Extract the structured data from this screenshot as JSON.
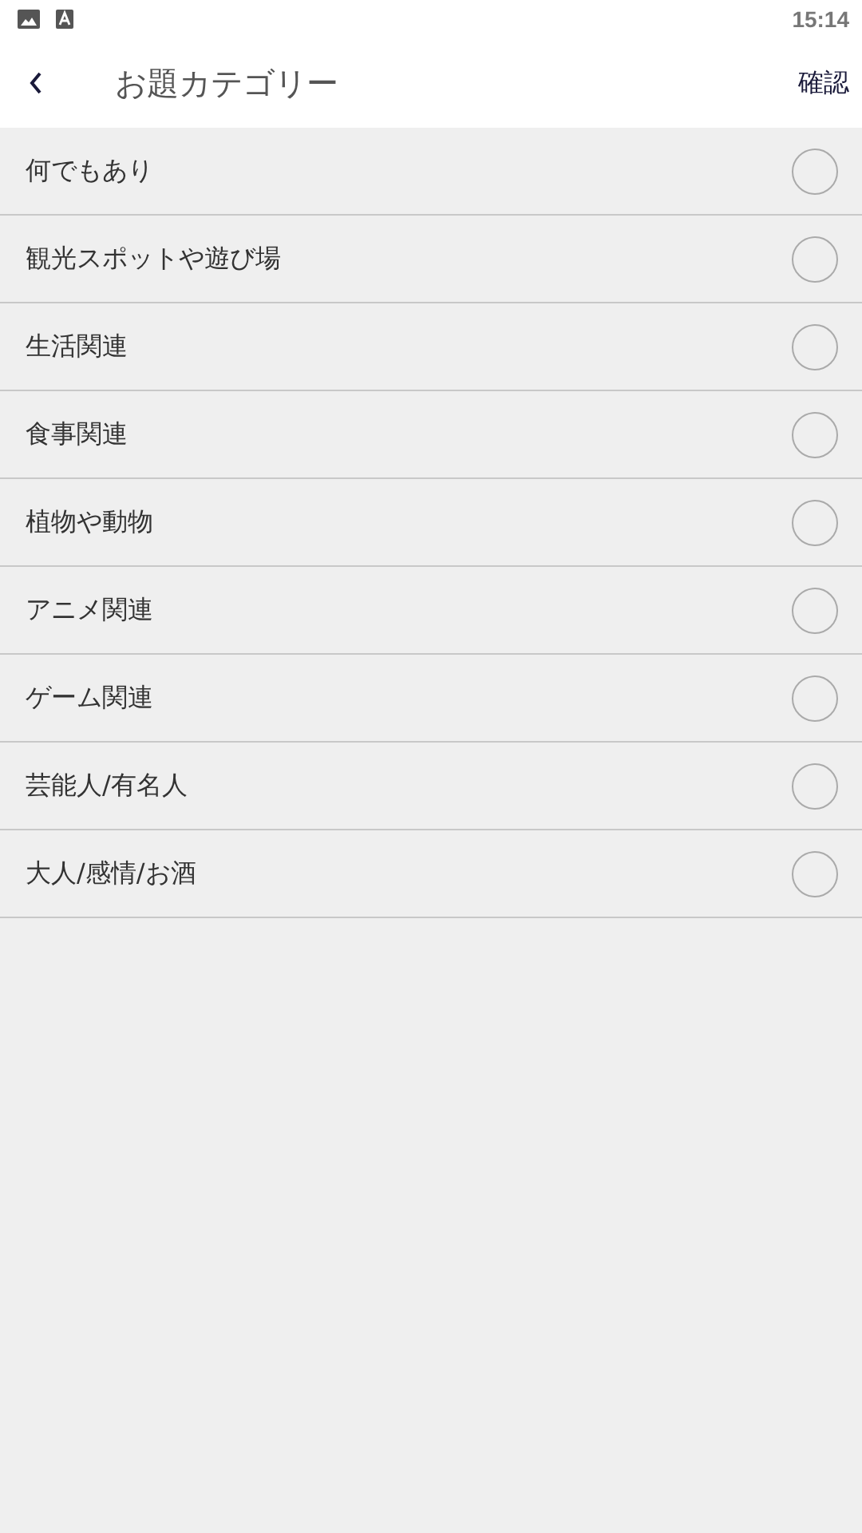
{
  "status_bar": {
    "time": "15:14"
  },
  "app_bar": {
    "title": "お題カテゴリー",
    "action": "確認"
  },
  "categories": [
    {
      "label": "何でもあり",
      "selected": false
    },
    {
      "label": "観光スポットや遊び場",
      "selected": false
    },
    {
      "label": "生活関連",
      "selected": false
    },
    {
      "label": "食事関連",
      "selected": false
    },
    {
      "label": "植物や動物",
      "selected": false
    },
    {
      "label": "アニメ関連",
      "selected": false
    },
    {
      "label": "ゲーム関連",
      "selected": false
    },
    {
      "label": "芸能人/有名人",
      "selected": false
    },
    {
      "label": "大人/感情/お酒",
      "selected": false
    }
  ]
}
